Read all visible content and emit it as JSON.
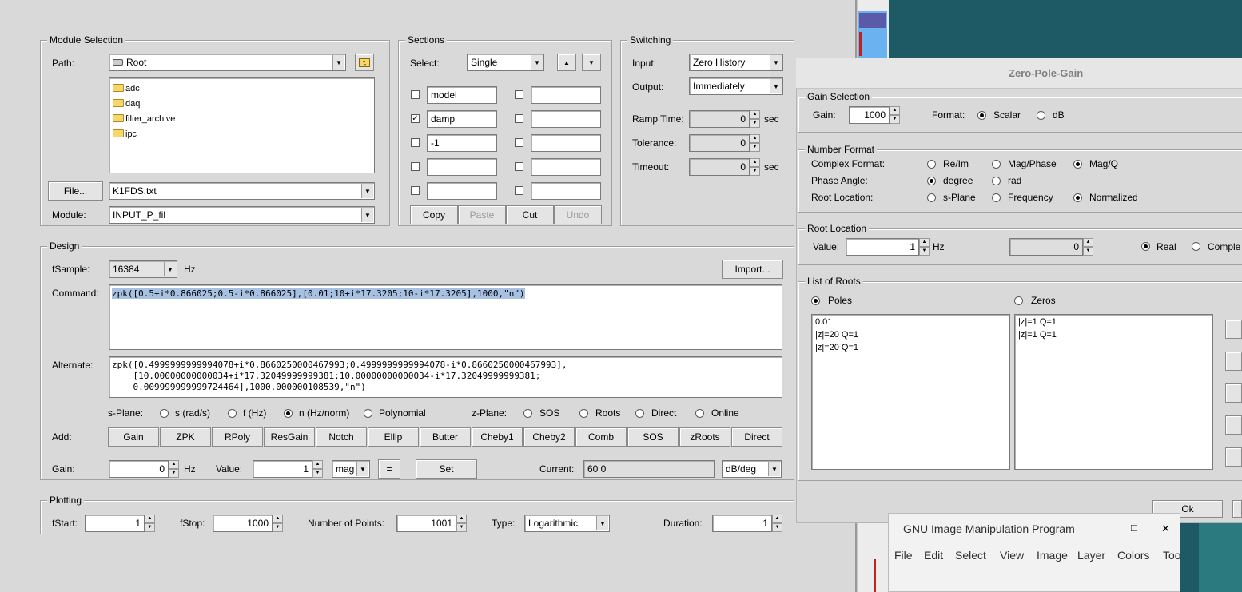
{
  "module_selection": {
    "title": "Module Selection",
    "path_label": "Path:",
    "path_value": "Root",
    "folders": [
      "adc",
      "daq",
      "filter_archive",
      "ipc"
    ],
    "file_button": "File...",
    "file_value": "K1FDS.txt",
    "module_label": "Module:",
    "module_value": "INPUT_P_fil"
  },
  "sections": {
    "title": "Sections",
    "select_label": "Select:",
    "select_value": "Single",
    "rows": [
      {
        "left_checked": false,
        "left": "model",
        "right_checked": false,
        "right": ""
      },
      {
        "left_checked": true,
        "left": "damp",
        "right_checked": false,
        "right": ""
      },
      {
        "left_checked": false,
        "left": "-1",
        "right_checked": false,
        "right": ""
      },
      {
        "left_checked": false,
        "left": "",
        "right_checked": false,
        "right": ""
      },
      {
        "left_checked": false,
        "left": "",
        "right_checked": false,
        "right": ""
      }
    ],
    "copy": "Copy",
    "paste": "Paste",
    "cut": "Cut",
    "undo": "Undo"
  },
  "switching": {
    "title": "Switching",
    "input_label": "Input:",
    "input_value": "Zero History",
    "output_label": "Output:",
    "output_value": "Immediately",
    "ramp_label": "Ramp Time:",
    "ramp_value": "0",
    "ramp_unit": "sec",
    "tol_label": "Tolerance:",
    "tol_value": "0",
    "timeout_label": "Timeout:",
    "timeout_value": "0",
    "timeout_unit": "sec"
  },
  "design": {
    "title": "Design",
    "fsample_label": "fSample:",
    "fsample_value": "16384",
    "fsample_unit": "Hz",
    "import_button": "Import...",
    "command_label": "Command:",
    "command_value": "zpk([0.5+i*0.866025;0.5-i*0.866025],[0.01;10+i*17.3205;10-i*17.3205],1000,\"n\")",
    "alternate_label": "Alternate:",
    "alternate_lines": [
      "zpk([0.4999999999994078+i*0.8660250000467993;0.4999999999994078-i*0.8660250000467993],",
      "    [10.00000000000034+i*17.32049999999381;10.00000000000034-i*17.32049999999381;",
      "    0.009999999999724464],1000.000000108539,\"n\")"
    ],
    "splane_label": "s-Plane:",
    "splane_options": [
      "s (rad/s)",
      "f (Hz)",
      "n (Hz/norm)",
      "Polynomial"
    ],
    "splane_selected": 2,
    "zplane_label": "z-Plane:",
    "zplane_options": [
      "SOS",
      "Roots",
      "Direct",
      "Online"
    ],
    "add_label": "Add:",
    "add_buttons": [
      "Gain",
      "ZPK",
      "RPoly",
      "ResGain",
      "Notch",
      "Ellip",
      "Butter",
      "Cheby1",
      "Cheby2",
      "Comb",
      "SOS",
      "zRoots",
      "Direct"
    ],
    "gain_label": "Gain:",
    "gain_value": "0",
    "gain_unit": "Hz",
    "value_label": "Value:",
    "value_value": "1",
    "mag_value": "mag",
    "eq_button": "=",
    "set_button": "Set",
    "current_label": "Current:",
    "current_value": "60  0",
    "unit_value": "dB/deg"
  },
  "plotting": {
    "title": "Plotting",
    "fstart_label": "fStart:",
    "fstart_value": "1",
    "fstop_label": "fStop:",
    "fstop_value": "1000",
    "npoints_label": "Number of Points:",
    "npoints_value": "1001",
    "type_label": "Type:",
    "type_value": "Logarithmic",
    "duration_label": "Duration:",
    "duration_value": "1"
  },
  "zpg": {
    "title": "Zero-Pole-Gain",
    "gain_sel": {
      "title": "Gain Selection",
      "gain_label": "Gain:",
      "gain_value": "1000",
      "format_label": "Format:",
      "scalar": "Scalar",
      "db": "dB"
    },
    "num_format": {
      "title": "Number Format",
      "complex_label": "Complex Format:",
      "complex_options": [
        "Re/Im",
        "Mag/Phase",
        "Mag/Q"
      ],
      "phase_label": "Phase Angle:",
      "phase_options": [
        "degree",
        "rad"
      ],
      "root_label": "Root Location:",
      "root_options": [
        "s-Plane",
        "Frequency",
        "Normalized"
      ]
    },
    "root_loc": {
      "title": "Root Location",
      "value_label": "Value:",
      "value": "1",
      "unit": "Hz",
      "second_value": "0",
      "real": "Real",
      "complex": "Comple"
    },
    "roots": {
      "title": "List of Roots",
      "poles": "Poles",
      "zeros": "Zeros",
      "pole_list": [
        "0.01",
        "|z|=20 Q=1",
        "|z|=20 Q=1"
      ],
      "zero_list": [
        "|z|=1 Q=1",
        "|z|=1 Q=1"
      ]
    },
    "ok": "Ok"
  },
  "gimp": {
    "title": "GNU Image Manipulation Program",
    "minimize": "–",
    "maximize": "□",
    "close": "✕",
    "menu": [
      "File",
      "Edit",
      "Select",
      "View",
      "Image",
      "Layer",
      "Colors",
      "Too"
    ]
  }
}
